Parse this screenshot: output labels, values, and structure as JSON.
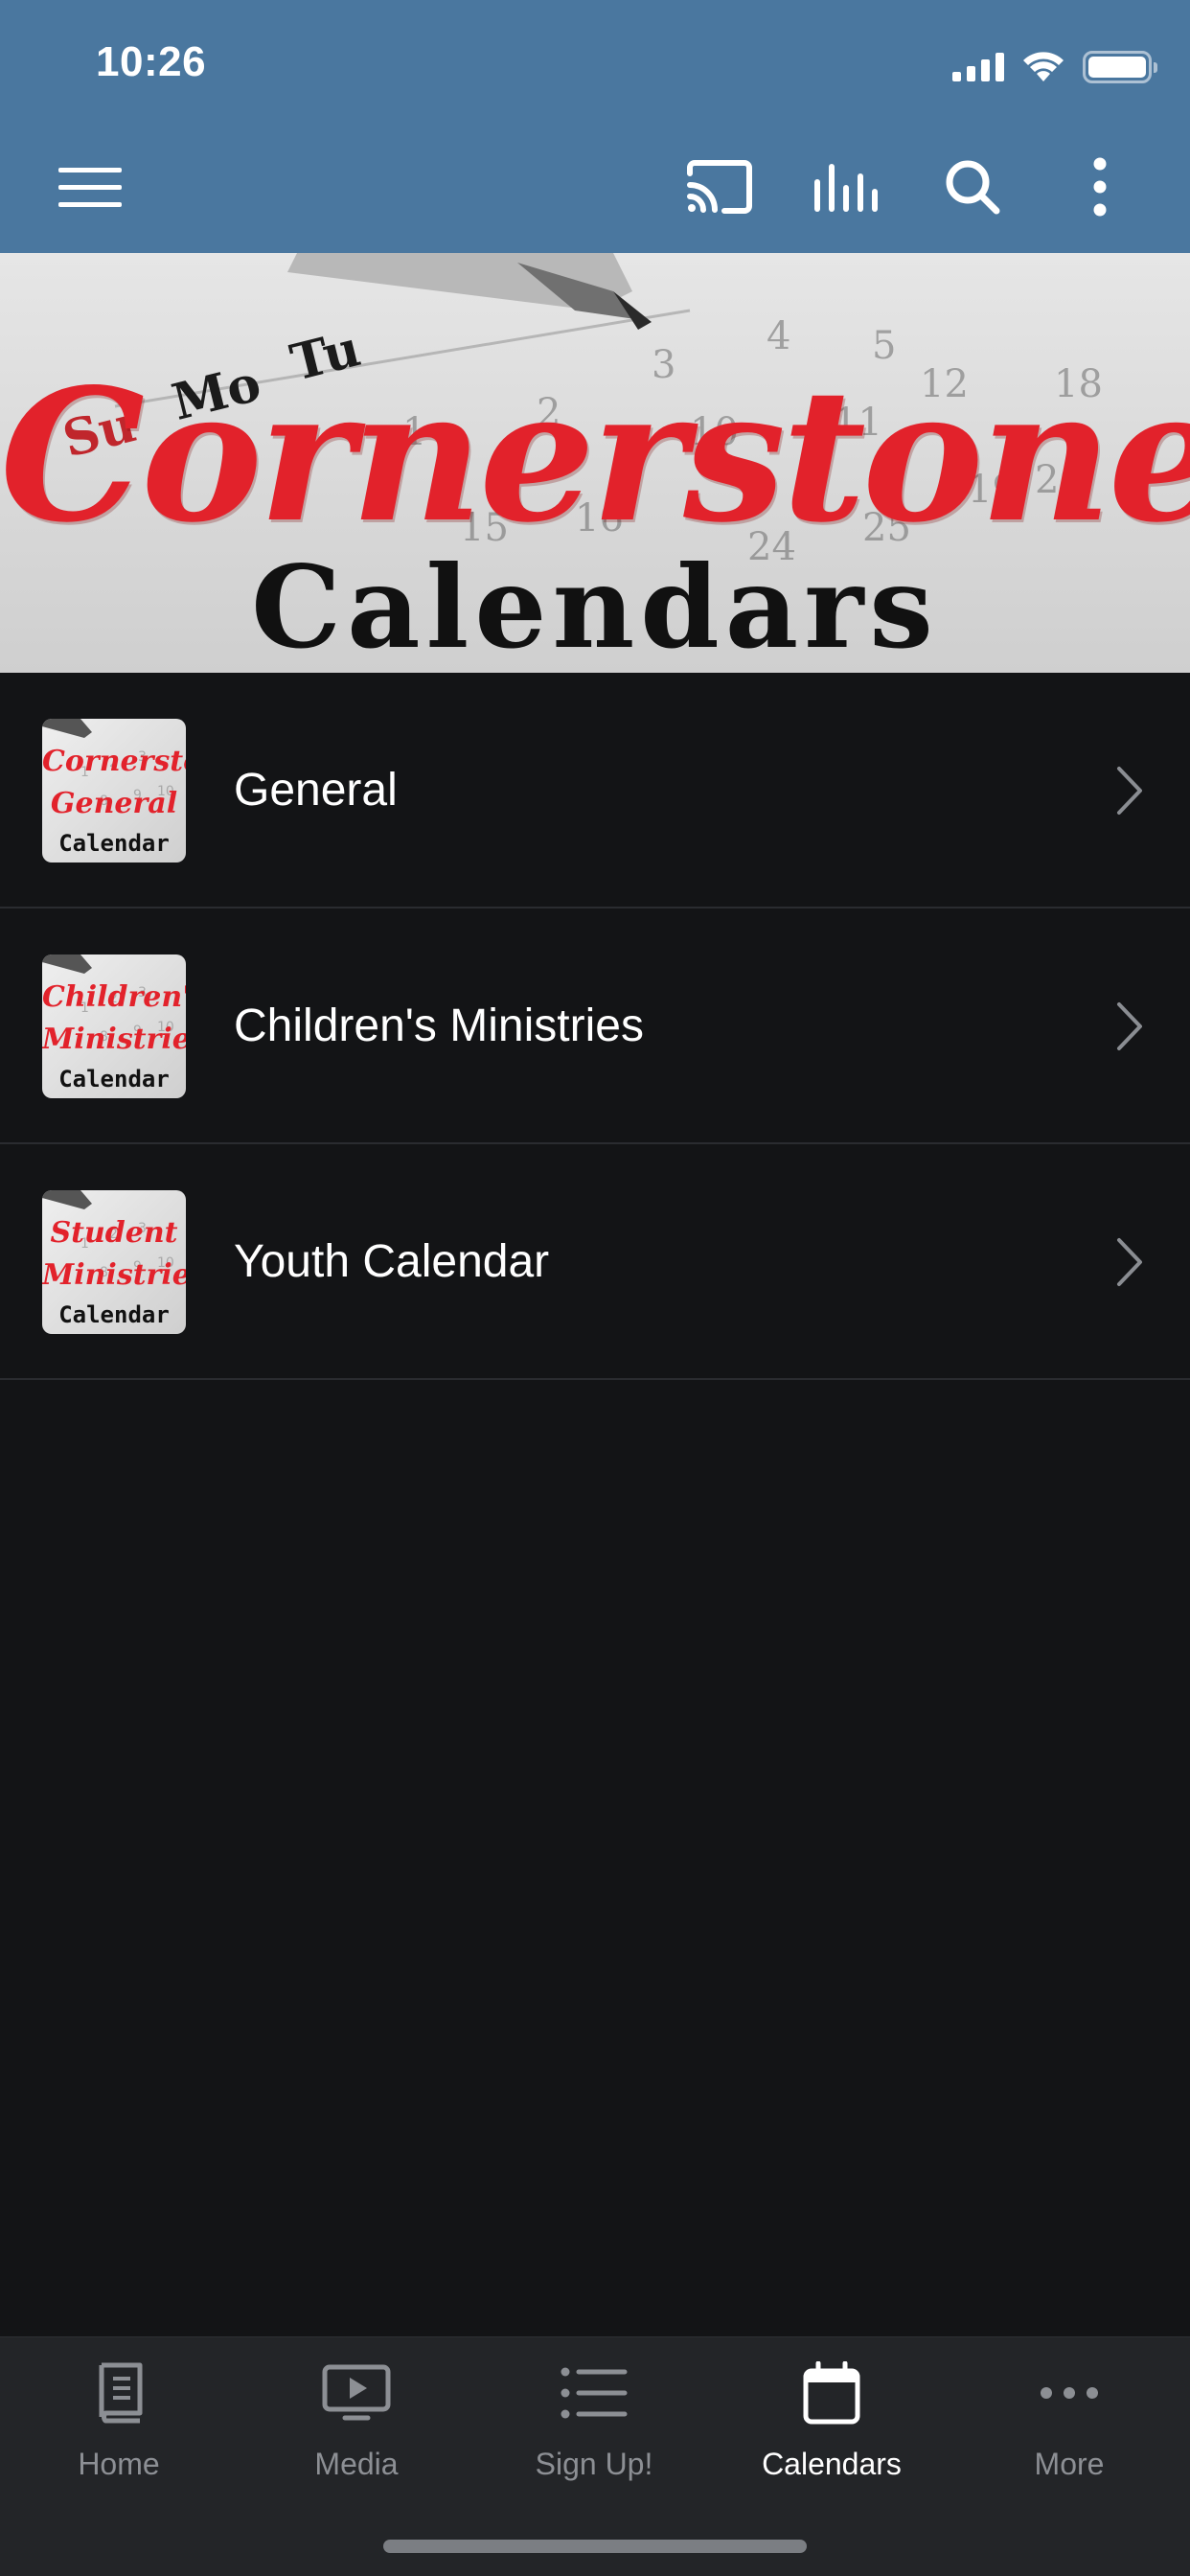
{
  "status_bar": {
    "time": "10:26"
  },
  "toolbar": {
    "icons": [
      "menu-icon",
      "cast-icon",
      "audio-bars-icon",
      "search-icon",
      "more-vertical-icon"
    ]
  },
  "banner": {
    "title": "Cornerstone",
    "subtitle": "Calendars",
    "calendar_marks": [
      "Su",
      "Mo",
      "Tu"
    ]
  },
  "list": {
    "items": [
      {
        "label": "General",
        "thumb_lines": [
          "Cornerstone",
          "General"
        ],
        "thumb_caption": "Calendar"
      },
      {
        "label": "Children's Ministries",
        "thumb_lines": [
          "Children's",
          "Ministries"
        ],
        "thumb_caption": "Calendar"
      },
      {
        "label": "Youth Calendar",
        "thumb_lines": [
          "Student",
          "Ministries"
        ],
        "thumb_caption": "Calendar"
      }
    ]
  },
  "tabbar": {
    "tabs": [
      {
        "label": "Home",
        "icon": "book-icon",
        "active": false
      },
      {
        "label": "Media",
        "icon": "play-screen-icon",
        "active": false
      },
      {
        "label": "Sign Up!",
        "icon": "list-icon",
        "active": false
      },
      {
        "label": "Calendars",
        "icon": "calendar-icon",
        "active": true
      },
      {
        "label": "More",
        "icon": "ellipsis-icon",
        "active": false
      }
    ]
  },
  "colors": {
    "header": "#4a779f",
    "background": "#131416",
    "tabbar": "#232528",
    "accent_red": "#e2222b",
    "tab_inactive": "#8c8f94"
  }
}
